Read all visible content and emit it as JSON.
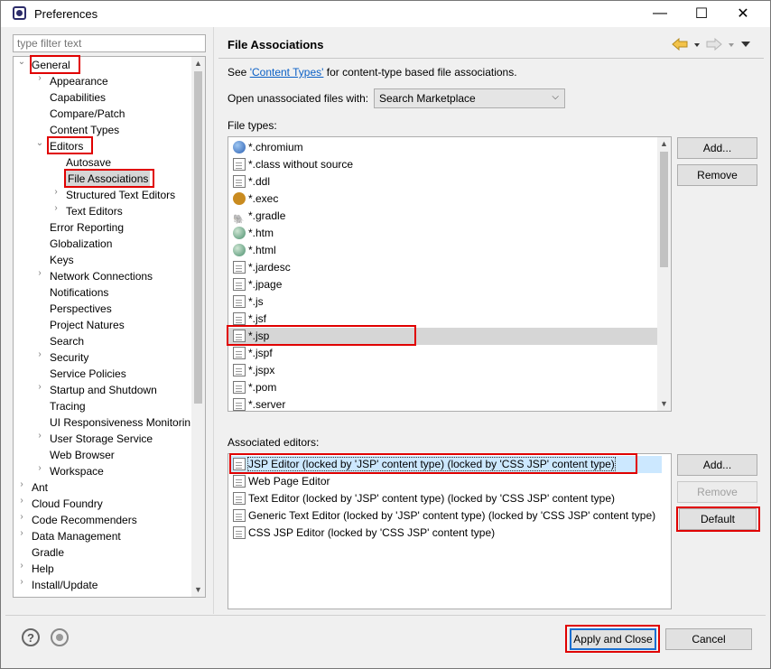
{
  "window": {
    "title": "Preferences",
    "minimize": "—",
    "maximize": "☐",
    "close": "✕"
  },
  "filter": {
    "placeholder": "type filter text"
  },
  "tree": {
    "items": [
      {
        "label": "General",
        "level": 0,
        "expander": "open"
      },
      {
        "label": "Appearance",
        "level": 1,
        "expander": "closed"
      },
      {
        "label": "Capabilities",
        "level": 1,
        "expander": "none"
      },
      {
        "label": "Compare/Patch",
        "level": 1,
        "expander": "none"
      },
      {
        "label": "Content Types",
        "level": 1,
        "expander": "none"
      },
      {
        "label": "Editors",
        "level": 1,
        "expander": "open"
      },
      {
        "label": "Autosave",
        "level": 2,
        "expander": "none"
      },
      {
        "label": "File Associations",
        "level": 2,
        "expander": "none",
        "selected": true
      },
      {
        "label": "Structured Text Editors",
        "level": 2,
        "expander": "closed"
      },
      {
        "label": "Text Editors",
        "level": 2,
        "expander": "closed"
      },
      {
        "label": "Error Reporting",
        "level": 1,
        "expander": "none"
      },
      {
        "label": "Globalization",
        "level": 1,
        "expander": "none"
      },
      {
        "label": "Keys",
        "level": 1,
        "expander": "none"
      },
      {
        "label": "Network Connections",
        "level": 1,
        "expander": "closed"
      },
      {
        "label": "Notifications",
        "level": 1,
        "expander": "none"
      },
      {
        "label": "Perspectives",
        "level": 1,
        "expander": "none"
      },
      {
        "label": "Project Natures",
        "level": 1,
        "expander": "none"
      },
      {
        "label": "Search",
        "level": 1,
        "expander": "none"
      },
      {
        "label": "Security",
        "level": 1,
        "expander": "closed"
      },
      {
        "label": "Service Policies",
        "level": 1,
        "expander": "none"
      },
      {
        "label": "Startup and Shutdown",
        "level": 1,
        "expander": "closed"
      },
      {
        "label": "Tracing",
        "level": 1,
        "expander": "none"
      },
      {
        "label": "UI Responsiveness Monitorin",
        "level": 1,
        "expander": "none"
      },
      {
        "label": "User Storage Service",
        "level": 1,
        "expander": "closed"
      },
      {
        "label": "Web Browser",
        "level": 1,
        "expander": "none"
      },
      {
        "label": "Workspace",
        "level": 1,
        "expander": "closed"
      },
      {
        "label": "Ant",
        "level": 0,
        "expander": "closed"
      },
      {
        "label": "Cloud Foundry",
        "level": 0,
        "expander": "closed"
      },
      {
        "label": "Code Recommenders",
        "level": 0,
        "expander": "closed"
      },
      {
        "label": "Data Management",
        "level": 0,
        "expander": "closed"
      },
      {
        "label": "Gradle",
        "level": 0,
        "expander": "none"
      },
      {
        "label": "Help",
        "level": 0,
        "expander": "closed"
      },
      {
        "label": "Install/Update",
        "level": 0,
        "expander": "closed"
      }
    ]
  },
  "page": {
    "title": "File Associations",
    "see_prefix": "See ",
    "see_link": "'Content Types'",
    "see_suffix": " for content-type based file associations.",
    "open_label": "Open unassociated files with:",
    "open_value": "Search Marketplace",
    "file_types_label": "File types:",
    "file_types": [
      {
        "label": "*.chromium",
        "icon": "chromium-icon"
      },
      {
        "label": "*.class without source",
        "icon": "class-file-icon"
      },
      {
        "label": "*.ddl",
        "icon": "ddl-file-icon"
      },
      {
        "label": "*.exec",
        "icon": "gear-icon"
      },
      {
        "label": "*.gradle",
        "icon": "gradle-icon"
      },
      {
        "label": "*.htm",
        "icon": "web-globe-icon"
      },
      {
        "label": "*.html",
        "icon": "web-globe-icon"
      },
      {
        "label": "*.jardesc",
        "icon": "jar-desc-icon"
      },
      {
        "label": "*.jpage",
        "icon": "jpage-icon"
      },
      {
        "label": "*.js",
        "icon": "js-file-icon"
      },
      {
        "label": "*.jsf",
        "icon": "text-file-icon"
      },
      {
        "label": "*.jsp",
        "icon": "text-file-icon",
        "selected": true
      },
      {
        "label": "*.jspf",
        "icon": "text-file-icon"
      },
      {
        "label": "*.jspx",
        "icon": "text-file-icon"
      },
      {
        "label": "*.pom",
        "icon": "maven-pom-icon"
      },
      {
        "label": "*.server",
        "icon": "server-icon"
      }
    ],
    "file_buttons": {
      "add": "Add...",
      "remove": "Remove"
    },
    "assoc_label": "Associated editors:",
    "editors": [
      {
        "label": "JSP Editor (locked by 'JSP' content type) (locked by 'CSS JSP' content type)",
        "icon": "text-file-icon",
        "selected": true
      },
      {
        "label": "Web Page Editor",
        "icon": "web-page-editor-icon"
      },
      {
        "label": "Text Editor (locked by 'JSP' content type) (locked by 'CSS JSP' content type)",
        "icon": "text-file-icon"
      },
      {
        "label": "Generic Text Editor (locked by 'JSP' content type) (locked by 'CSS JSP' content type)",
        "icon": "generic-editor-icon"
      },
      {
        "label": "CSS JSP Editor (locked by 'CSS JSP' content type)",
        "icon": "text-file-icon"
      }
    ],
    "editor_buttons": {
      "add": "Add...",
      "remove": "Remove",
      "default": "Default"
    }
  },
  "footer": {
    "apply_close": "Apply and Close",
    "cancel": "Cancel"
  },
  "colors": {
    "highlight": "#e00000",
    "link": "#0b60c6",
    "selection": "#d6d6d6"
  }
}
